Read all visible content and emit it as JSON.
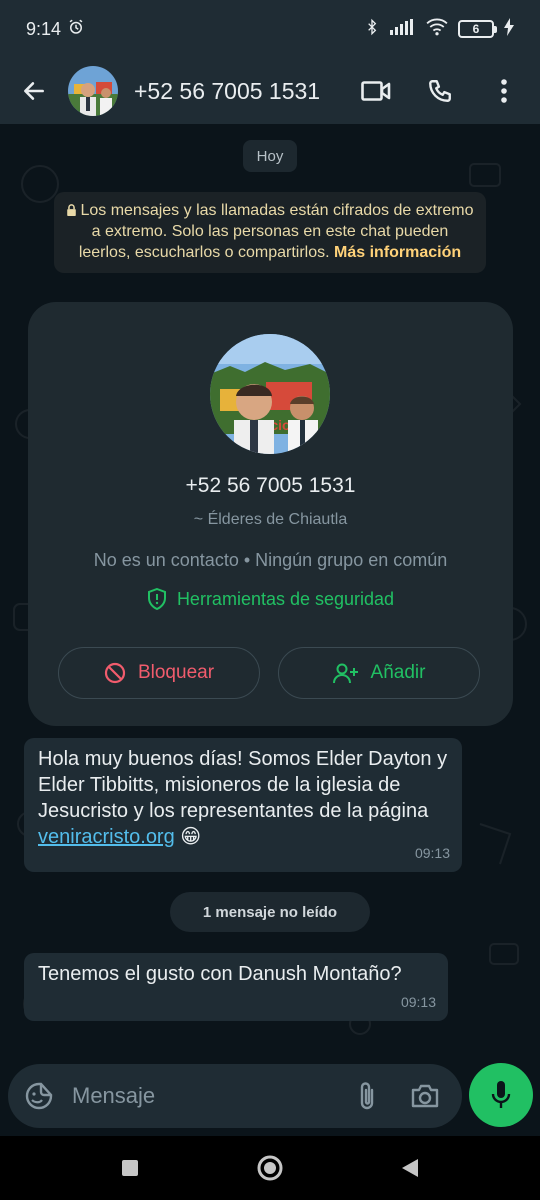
{
  "status_bar": {
    "time": "9:14",
    "battery_level": "6",
    "icons": [
      "alarm-icon",
      "bluetooth-icon",
      "signal-icon",
      "wifi-icon",
      "battery-icon",
      "charging-icon"
    ]
  },
  "header": {
    "title": "+52 56 7005 1531",
    "icons": [
      "back-arrow-icon",
      "video-call-icon",
      "voice-call-icon",
      "more-vert-icon"
    ]
  },
  "chat": {
    "day_label": "Hoy",
    "e2e_notice": {
      "text": "Los mensajes y las llamadas están cifrados de extremo a extremo. Solo las personas en este chat pueden leerlos, escucharlos o compartirlos.",
      "more_link": "Más información"
    },
    "contact_card": {
      "number": "+52 56 7005 1531",
      "name": "~ Élderes de Chiautla",
      "info": "No es un contacto • Ningún grupo en común",
      "safety_tools": "Herramientas de seguridad",
      "block_label": "Bloquear",
      "add_label": "Añadir"
    },
    "messages": [
      {
        "text_before_link": "Hola muy buenos días! Somos Elder Dayton y Elder Tibbitts, misioneros de la iglesia de Jesucristo y los representantes de la página ",
        "link": "veniracristo.org",
        "emoji": "😁",
        "time": "09:13"
      },
      {
        "text": "Tenemos el gusto con Danush Montaño?",
        "time": "09:13"
      }
    ],
    "unread_label": "1 mensaje no leído"
  },
  "composer": {
    "placeholder": "Mensaje"
  },
  "colors": {
    "accent_green": "#21c063",
    "block_red": "#f15c6d",
    "link_blue": "#53bdeb",
    "notice_yellow": "#ffd279",
    "bubble_bg": "#1f2c34",
    "chat_bg": "#0b141a"
  }
}
